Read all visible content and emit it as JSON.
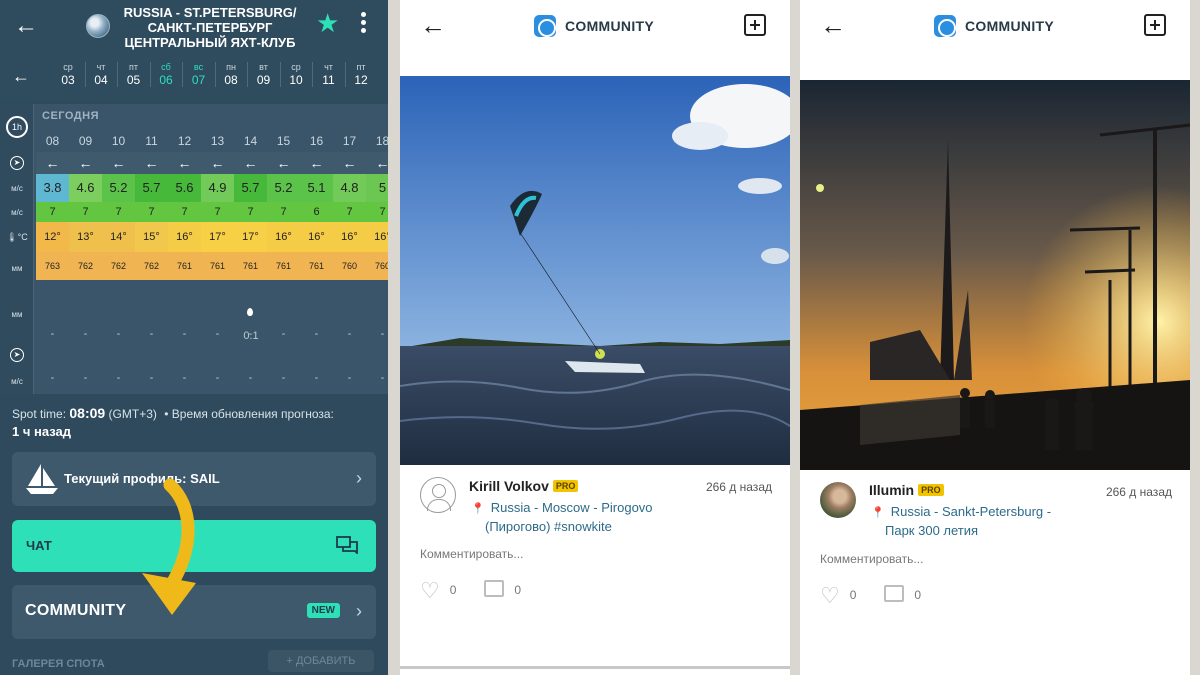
{
  "left_panel": {
    "title_line1": "RUSSIA - ST.PETERSBURG/",
    "title_line2": "САНКТ-ПЕТЕРБУРГ",
    "title_line3": "ЦЕНТРАЛЬНЫЙ ЯХТ-КЛУБ",
    "days": [
      {
        "name": "ср",
        "num": "03"
      },
      {
        "name": "чт",
        "num": "04"
      },
      {
        "name": "пт",
        "num": "05"
      },
      {
        "name": "сб",
        "num": "06"
      },
      {
        "name": "вс",
        "num": "07"
      },
      {
        "name": "пн",
        "num": "08"
      },
      {
        "name": "вт",
        "num": "09"
      },
      {
        "name": "ср",
        "num": "10"
      },
      {
        "name": "чт",
        "num": "11"
      },
      {
        "name": "пт",
        "num": "12"
      }
    ],
    "interval_label": "1h",
    "today_label": "СЕГОДНЯ",
    "units": {
      "wind": "м/с",
      "gust": "м/с",
      "temp": "°C",
      "pressure": "мм",
      "precip": "мм",
      "wave_wind": "м/с"
    },
    "hours": [
      "08",
      "09",
      "10",
      "11",
      "12",
      "13",
      "14",
      "15",
      "16",
      "17",
      "18"
    ],
    "wind": [
      "3.8",
      "4.6",
      "5.2",
      "5.7",
      "5.6",
      "4.9",
      "5.7",
      "5.2",
      "5.1",
      "4.8",
      "5"
    ],
    "wind_colors": [
      "#5fb8d2",
      "#7ccf5e",
      "#5cc34a",
      "#46b83a",
      "#46b83a",
      "#72cb58",
      "#46b83a",
      "#5cc34a",
      "#5cc34a",
      "#72cb58",
      "#6bc752"
    ],
    "gust": [
      "7",
      "7",
      "7",
      "7",
      "7",
      "7",
      "7",
      "7",
      "6",
      "7",
      "7"
    ],
    "temp": [
      "12°",
      "13°",
      "14°",
      "15°",
      "16°",
      "17°",
      "17°",
      "16°",
      "16°",
      "16°",
      "16°"
    ],
    "pressure": [
      "763",
      "762",
      "762",
      "762",
      "761",
      "761",
      "761",
      "761",
      "761",
      "760",
      "760"
    ],
    "precip": [
      "-",
      "-",
      "-",
      "-",
      "-",
      "-",
      "-",
      "-",
      "-",
      "-",
      "-"
    ],
    "precip_value": "0.1",
    "spot_time_label": "Spot time:",
    "spot_time": "08:09",
    "timezone": "(GMT+3)",
    "update_label": "Время обновления прогноза:",
    "update_ago": "1 ч назад",
    "profile_label": "Текущий профиль: SAIL",
    "chat_label": "ЧАТ",
    "community_label": "COMMUNITY",
    "new_badge": "NEW",
    "gallery_label": "ГАЛЕРЕЯ СПОТА",
    "add_label": "+ ДОБАВИТЬ",
    "accent_color": "#2ee0b8",
    "arrow_color": "#f0b91a"
  },
  "community_title": "COMMUNITY",
  "posts": [
    {
      "author": "Kirill Volkov",
      "badge": "PRO",
      "ago": "266 д назад",
      "location_line1": "Russia - Moscow - Pirogovo",
      "location_line2": "(Пирогово) #snowkite",
      "comment_placeholder": "Комментировать...",
      "likes": "0",
      "comments": "0"
    },
    {
      "author": "Illumin",
      "badge": "PRO",
      "ago": "266 д назад",
      "location_line1": "Russia - Sankt-Petersburg -",
      "location_line2": "Парк 300 летия",
      "comment_placeholder": "Комментировать...",
      "likes": "0",
      "comments": "0"
    }
  ]
}
